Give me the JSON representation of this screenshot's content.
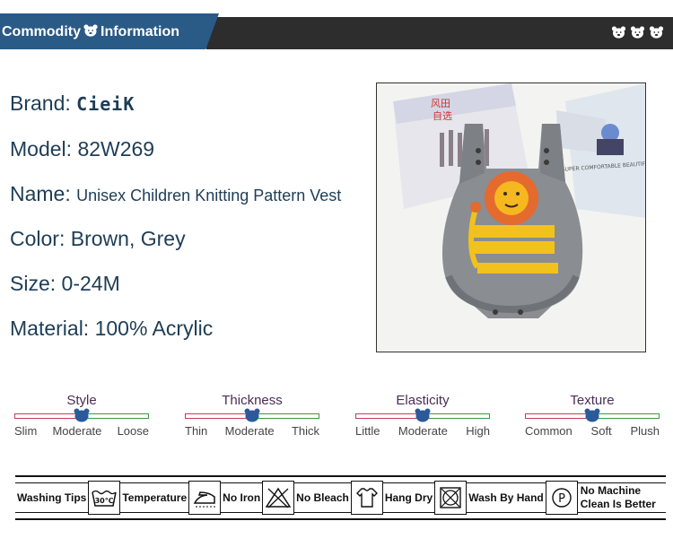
{
  "header": {
    "title_left": "Commodity",
    "title_right": "Information",
    "bear_icon": "bear-icon"
  },
  "info": {
    "brand_label": "Brand:",
    "brand_value": "CieiK",
    "model_label": "Model:",
    "model_value": "82W269",
    "name_label": "Name:",
    "name_value": "Unisex Children Knitting Pattern Vest",
    "color_label": "Color:",
    "color_value": "Brown, Grey",
    "size_label": "Size:",
    "size_value": "0-24M",
    "material_label": "Material:",
    "material_value": "100% Acrylic"
  },
  "photo": {
    "magazine_text_1": "风田",
    "magazine_text_2": "自选",
    "card_text": "SUPER COMFORTABLE BEAUTIFUL SHIRT"
  },
  "scales": [
    {
      "title": "Style",
      "labels": [
        "Slim",
        "Moderate",
        "Loose"
      ],
      "level": 0.5
    },
    {
      "title": "Thickness",
      "labels": [
        "Thin",
        "Moderate",
        "Thick"
      ],
      "level": 0.5
    },
    {
      "title": "Elasticity",
      "labels": [
        "Little",
        "Moderate",
        "High"
      ],
      "level": 0.5
    },
    {
      "title": "Texture",
      "labels": [
        "Common",
        "Soft",
        "Plush"
      ],
      "level": 0.5
    }
  ],
  "washing": {
    "title": "Washing Tips",
    "temp_icon_text": "30℃",
    "temperature": "Temperature",
    "no_iron": "No Iron",
    "no_bleach": "No Bleach",
    "hang_dry": "Hang Dry",
    "wash_by_hand": "Wash By Hand",
    "no_machine": "No Machine",
    "clean_better": "Clean Is Better",
    "p_icon_text": "P"
  },
  "colors": {
    "header_blue": "#2a5a86",
    "header_dark": "#2d2d2d",
    "scale_left": "#c93a5a",
    "scale_right": "#3a9a44",
    "knob": "#2a5a9a"
  }
}
